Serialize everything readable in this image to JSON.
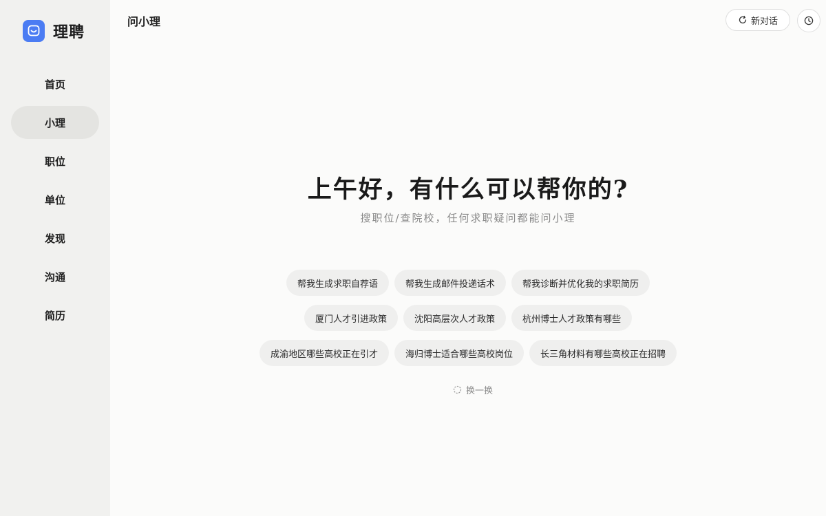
{
  "brand": {
    "name": "理聘",
    "logo_icon": "chat-face-icon",
    "logo_color": "#4b7cf3"
  },
  "sidebar": {
    "items": [
      {
        "label": "首页",
        "active": false
      },
      {
        "label": "小理",
        "active": true
      },
      {
        "label": "职位",
        "active": false
      },
      {
        "label": "单位",
        "active": false
      },
      {
        "label": "发现",
        "active": false
      },
      {
        "label": "沟通",
        "active": false
      },
      {
        "label": "简历",
        "active": false
      }
    ]
  },
  "header": {
    "title": "问小理",
    "new_chat_label": "新对话",
    "new_chat_icon": "new-chat-icon",
    "history_icon": "clock-icon"
  },
  "main": {
    "greeting": "上午好，有什么可以帮你的?",
    "subtitle": "搜职位/查院校，任何求职疑问都能问小理",
    "suggestions": [
      [
        "帮我生成求职自荐语",
        "帮我生成邮件投递话术",
        "帮我诊断并优化我的求职简历"
      ],
      [
        "厦门人才引进政策",
        "沈阳高层次人才政策",
        "杭州博士人才政策有哪些"
      ],
      [
        "成渝地区哪些高校正在引才",
        "海归博士适合哪些高校岗位",
        "长三角材料有哪些高校正在招聘"
      ]
    ],
    "refresh_label": "换一换",
    "refresh_icon": "refresh-icon"
  }
}
